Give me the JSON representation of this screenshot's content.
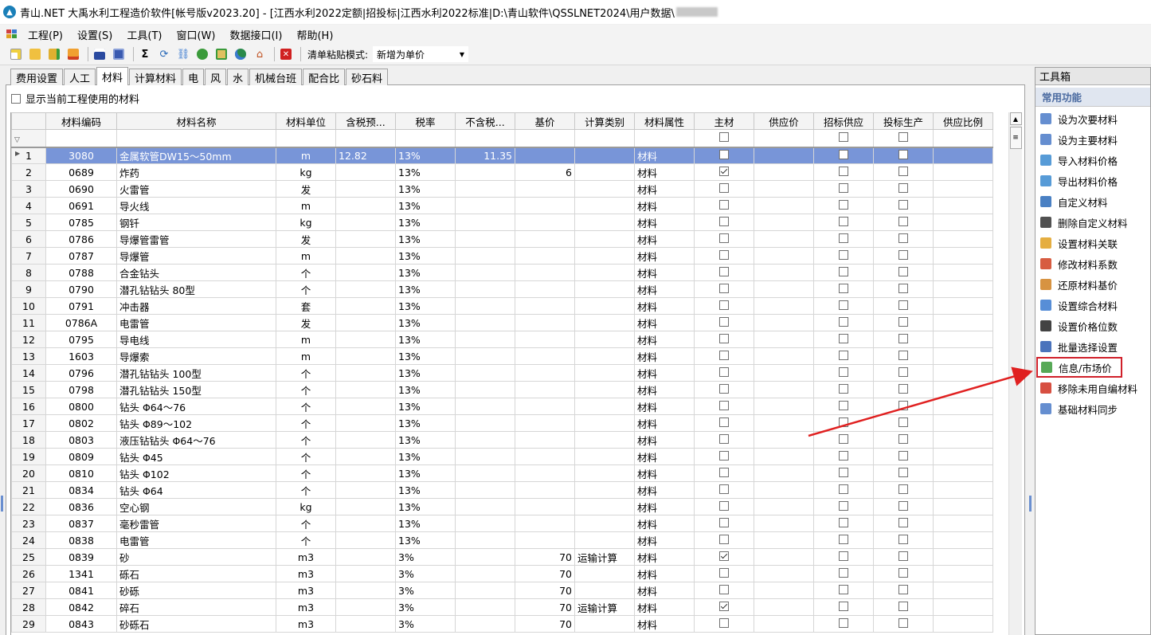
{
  "window": {
    "title": "青山.NET 大禹水利工程造价软件[帐号版v2023.20] - [江西水利2022定额|招投标|江西水利2022标准|D:\\青山软件\\QSSLNET2024\\用户数据\\",
    "title_redacted": "（已模糊）"
  },
  "menu": [
    "工程(P)",
    "设置(S)",
    "工具(T)",
    "窗口(W)",
    "数据接口(I)",
    "帮助(H)"
  ],
  "toolbar": {
    "paste_label": "清单粘贴模式:",
    "paste_value": "新增为单价",
    "sigma": "Σ"
  },
  "tabs": [
    "费用设置",
    "人工",
    "材料",
    "计算材料",
    "电",
    "风",
    "水",
    "机械台班",
    "配合比",
    "砂石料"
  ],
  "active_tab": "材料",
  "show_used_label": "显示当前工程使用的材料",
  "columns": [
    "材料编码",
    "材料名称",
    "材料单位",
    "含税预...",
    "税率",
    "不含税...",
    "基价",
    "计算类别",
    "材料属性",
    "主材",
    "供应价",
    "招标供应",
    "投标生产",
    "供应比例"
  ],
  "rows": [
    {
      "n": "1",
      "code": "3080",
      "name": "金属软管DW15～50mm",
      "unit": "m",
      "taxprice": "12.82",
      "rate": "13%",
      "notax": "11.35",
      "base": "",
      "calc": "",
      "attr": "材料",
      "main": false
    },
    {
      "n": "2",
      "code": "0689",
      "name": "炸药",
      "unit": "kg",
      "taxprice": "",
      "rate": "13%",
      "notax": "",
      "base": "6",
      "calc": "",
      "attr": "材料",
      "main": true
    },
    {
      "n": "3",
      "code": "0690",
      "name": "火雷管",
      "unit": "发",
      "taxprice": "",
      "rate": "13%",
      "notax": "",
      "base": "",
      "calc": "",
      "attr": "材料",
      "main": false
    },
    {
      "n": "4",
      "code": "0691",
      "name": "导火线",
      "unit": "m",
      "taxprice": "",
      "rate": "13%",
      "notax": "",
      "base": "",
      "calc": "",
      "attr": "材料",
      "main": false
    },
    {
      "n": "5",
      "code": "0785",
      "name": "钢钎",
      "unit": "kg",
      "taxprice": "",
      "rate": "13%",
      "notax": "",
      "base": "",
      "calc": "",
      "attr": "材料",
      "main": false
    },
    {
      "n": "6",
      "code": "0786",
      "name": "导爆管雷管",
      "unit": "发",
      "taxprice": "",
      "rate": "13%",
      "notax": "",
      "base": "",
      "calc": "",
      "attr": "材料",
      "main": false
    },
    {
      "n": "7",
      "code": "0787",
      "name": "导爆管",
      "unit": "m",
      "taxprice": "",
      "rate": "13%",
      "notax": "",
      "base": "",
      "calc": "",
      "attr": "材料",
      "main": false
    },
    {
      "n": "8",
      "code": "0788",
      "name": "合金钻头",
      "unit": "个",
      "taxprice": "",
      "rate": "13%",
      "notax": "",
      "base": "",
      "calc": "",
      "attr": "材料",
      "main": false
    },
    {
      "n": "9",
      "code": "0790",
      "name": "潜孔钻钻头 80型",
      "unit": "个",
      "taxprice": "",
      "rate": "13%",
      "notax": "",
      "base": "",
      "calc": "",
      "attr": "材料",
      "main": false
    },
    {
      "n": "10",
      "code": "0791",
      "name": "冲击器",
      "unit": "套",
      "taxprice": "",
      "rate": "13%",
      "notax": "",
      "base": "",
      "calc": "",
      "attr": "材料",
      "main": false
    },
    {
      "n": "11",
      "code": "0786A",
      "name": "电雷管",
      "unit": "发",
      "taxprice": "",
      "rate": "13%",
      "notax": "",
      "base": "",
      "calc": "",
      "attr": "材料",
      "main": false
    },
    {
      "n": "12",
      "code": "0795",
      "name": "导电线",
      "unit": "m",
      "taxprice": "",
      "rate": "13%",
      "notax": "",
      "base": "",
      "calc": "",
      "attr": "材料",
      "main": false
    },
    {
      "n": "13",
      "code": "1603",
      "name": "导爆索",
      "unit": "m",
      "taxprice": "",
      "rate": "13%",
      "notax": "",
      "base": "",
      "calc": "",
      "attr": "材料",
      "main": false
    },
    {
      "n": "14",
      "code": "0796",
      "name": "潜孔钻钻头 100型",
      "unit": "个",
      "taxprice": "",
      "rate": "13%",
      "notax": "",
      "base": "",
      "calc": "",
      "attr": "材料",
      "main": false
    },
    {
      "n": "15",
      "code": "0798",
      "name": "潜孔钻钻头 150型",
      "unit": "个",
      "taxprice": "",
      "rate": "13%",
      "notax": "",
      "base": "",
      "calc": "",
      "attr": "材料",
      "main": false
    },
    {
      "n": "16",
      "code": "0800",
      "name": "钻头 Φ64～76",
      "unit": "个",
      "taxprice": "",
      "rate": "13%",
      "notax": "",
      "base": "",
      "calc": "",
      "attr": "材料",
      "main": false
    },
    {
      "n": "17",
      "code": "0802",
      "name": "钻头 Φ89～102",
      "unit": "个",
      "taxprice": "",
      "rate": "13%",
      "notax": "",
      "base": "",
      "calc": "",
      "attr": "材料",
      "main": false
    },
    {
      "n": "18",
      "code": "0803",
      "name": "液压钻钻头 Φ64～76",
      "unit": "个",
      "taxprice": "",
      "rate": "13%",
      "notax": "",
      "base": "",
      "calc": "",
      "attr": "材料",
      "main": false
    },
    {
      "n": "19",
      "code": "0809",
      "name": "钻头 Φ45",
      "unit": "个",
      "taxprice": "",
      "rate": "13%",
      "notax": "",
      "base": "",
      "calc": "",
      "attr": "材料",
      "main": false
    },
    {
      "n": "20",
      "code": "0810",
      "name": "钻头 Φ102",
      "unit": "个",
      "taxprice": "",
      "rate": "13%",
      "notax": "",
      "base": "",
      "calc": "",
      "attr": "材料",
      "main": false
    },
    {
      "n": "21",
      "code": "0834",
      "name": "钻头 Φ64",
      "unit": "个",
      "taxprice": "",
      "rate": "13%",
      "notax": "",
      "base": "",
      "calc": "",
      "attr": "材料",
      "main": false
    },
    {
      "n": "22",
      "code": "0836",
      "name": "空心钢",
      "unit": "kg",
      "taxprice": "",
      "rate": "13%",
      "notax": "",
      "base": "",
      "calc": "",
      "attr": "材料",
      "main": false
    },
    {
      "n": "23",
      "code": "0837",
      "name": "毫秒雷管",
      "unit": "个",
      "taxprice": "",
      "rate": "13%",
      "notax": "",
      "base": "",
      "calc": "",
      "attr": "材料",
      "main": false
    },
    {
      "n": "24",
      "code": "0838",
      "name": "电雷管",
      "unit": "个",
      "taxprice": "",
      "rate": "13%",
      "notax": "",
      "base": "",
      "calc": "",
      "attr": "材料",
      "main": false
    },
    {
      "n": "25",
      "code": "0839",
      "name": "砂",
      "unit": "m3",
      "taxprice": "",
      "rate": "3%",
      "notax": "",
      "base": "70",
      "calc": "运输计算",
      "attr": "材料",
      "main": true
    },
    {
      "n": "26",
      "code": "1341",
      "name": "砾石",
      "unit": "m3",
      "taxprice": "",
      "rate": "3%",
      "notax": "",
      "base": "70",
      "calc": "",
      "attr": "材料",
      "main": false
    },
    {
      "n": "27",
      "code": "0841",
      "name": "砂砾",
      "unit": "m3",
      "taxprice": "",
      "rate": "3%",
      "notax": "",
      "base": "70",
      "calc": "",
      "attr": "材料",
      "main": false
    },
    {
      "n": "28",
      "code": "0842",
      "name": "碎石",
      "unit": "m3",
      "taxprice": "",
      "rate": "3%",
      "notax": "",
      "base": "70",
      "calc": "运输计算",
      "attr": "材料",
      "main": true
    },
    {
      "n": "29",
      "code": "0843",
      "name": "砂砾石",
      "unit": "m3",
      "taxprice": "",
      "rate": "3%",
      "notax": "",
      "base": "70",
      "calc": "",
      "attr": "材料",
      "main": false
    }
  ],
  "toolbox": {
    "title": "工具箱",
    "section": "常用功能",
    "items": [
      {
        "label": "设为次要材料",
        "icon": "document-icon",
        "color": "#4a7ac8"
      },
      {
        "label": "设为主要材料",
        "icon": "document-edit-icon",
        "color": "#4a7ac8"
      },
      {
        "label": "导入材料价格",
        "icon": "import-icon",
        "color": "#3a8ad0"
      },
      {
        "label": "导出材料价格",
        "icon": "export-icon",
        "color": "#3a8ad0"
      },
      {
        "label": "自定义材料",
        "icon": "custom-icon",
        "color": "#2a6ab8"
      },
      {
        "label": "删除自定义材料",
        "icon": "delete-icon",
        "color": "#333333"
      },
      {
        "label": "设置材料关联",
        "icon": "link-icon",
        "color": "#e0a020"
      },
      {
        "label": "修改材料系数",
        "icon": "pencil-icon",
        "color": "#d04020"
      },
      {
        "label": "还原材料基价",
        "icon": "restore-icon",
        "color": "#d08020"
      },
      {
        "label": "设置综合材料",
        "icon": "combine-icon",
        "color": "#3a7ad0"
      },
      {
        "label": "设置价格位数",
        "icon": "ball-icon",
        "color": "#222222"
      },
      {
        "label": "批量选择设置",
        "icon": "chart-icon",
        "color": "#2a5ab0"
      },
      {
        "label": "信息/市场价",
        "icon": "sheet-icon",
        "color": "#3a9a3a"
      },
      {
        "label": "移除未用自编材料",
        "icon": "remove-icon",
        "color": "#d03020"
      },
      {
        "label": "基础材料同步",
        "icon": "sync-icon",
        "color": "#4a7ac8"
      }
    ]
  },
  "highlighted_item": "信息/市场价"
}
